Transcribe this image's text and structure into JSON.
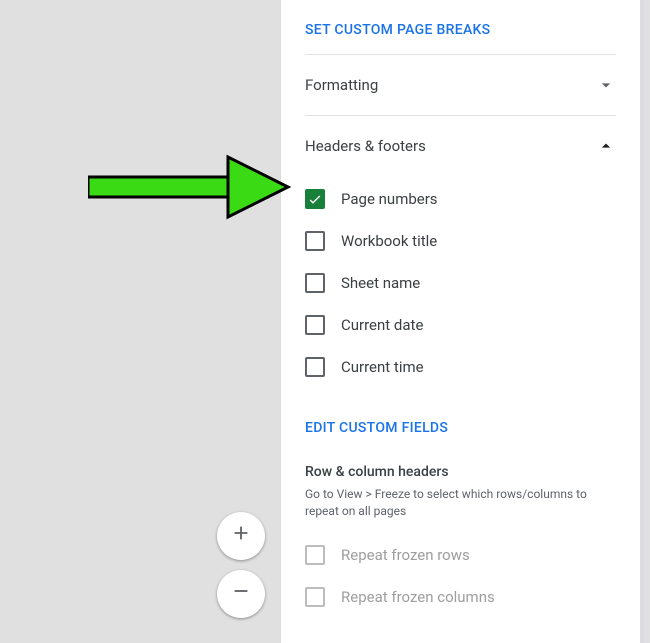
{
  "links": {
    "set_custom_page_breaks": "SET CUSTOM PAGE BREAKS",
    "edit_custom_fields": "EDIT CUSTOM FIELDS"
  },
  "accordion": {
    "formatting": "Formatting",
    "headers_footers": "Headers & footers"
  },
  "hf_options": {
    "page_numbers": "Page numbers",
    "workbook_title": "Workbook title",
    "sheet_name": "Sheet name",
    "current_date": "Current date",
    "current_time": "Current time"
  },
  "row_col": {
    "title": "Row & column headers",
    "help": "Go to View > Freeze to select which rows/columns to repeat on all pages",
    "repeat_rows": "Repeat frozen rows",
    "repeat_cols": "Repeat frozen columns"
  }
}
